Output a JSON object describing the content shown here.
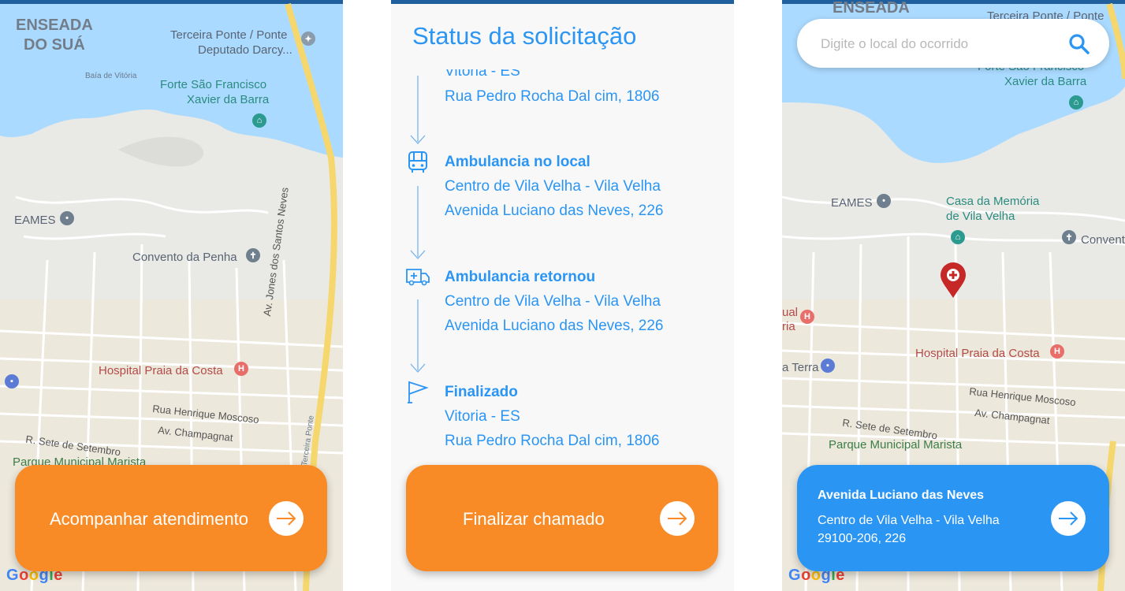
{
  "screen_left": {
    "map_labels": {
      "enseada_1": "ENSEADA",
      "enseada_2": "DO SUÁ",
      "terceira_ponte_1": "Terceira Ponte / Ponte",
      "terceira_ponte_2": "Deputado Darcy...",
      "baia": "Baía de Vitória",
      "forte_1": "Forte São Francisco",
      "forte_2": "Xavier da Barra",
      "eames": "EAMES",
      "convento": "Convento da Penha",
      "hospital": "Hospital Praia da Costa",
      "rua_henrique": "Rua Henrique Moscoso",
      "av_champagnat": "Av. Champagnat",
      "r_sete": "R. Sete de Setembro",
      "parque": "Parque Municipal Marista",
      "av_jones": "Av. Jones dos Santos Neves",
      "terceira_ponte_road": "Terceira Ponte"
    },
    "button_label": "Acompanhar atendimento"
  },
  "screen_middle": {
    "title": "Status da solicitação",
    "steps": [
      {
        "title": "",
        "line1": "Vitoria - ES",
        "line2": "Rua Pedro Rocha Dal cim, 1806",
        "icon": "arrow-down-icon"
      },
      {
        "title": "Ambulancia no local",
        "line1": "Centro de Vila Velha - Vila Velha",
        "line2": "Avenida Luciano das Neves, 226",
        "icon": "bus-icon"
      },
      {
        "title": "Ambulancia retornou",
        "line1": "Centro de Vila Velha - Vila Velha",
        "line2": "Avenida Luciano das Neves, 226",
        "icon": "ambulance-icon"
      },
      {
        "title": "Finalizado",
        "line1": "Vitoria - ES",
        "line2": "Rua Pedro Rocha Dal cim, 1806",
        "icon": "flag-icon"
      }
    ],
    "button_label": "Finalizar chamado"
  },
  "screen_right": {
    "search_placeholder": "Digite o local do ocorrido",
    "map_labels": {
      "enseada": "ENSEADA",
      "terceira_ponte": "Terceira Ponte / Ponte",
      "forte_1": "Forte São Francisco",
      "forte_2": "Xavier da Barra",
      "eames": "EAMES",
      "casa_1": "Casa da Memória",
      "casa_2": "de Vila Velha",
      "convento": "Convent",
      "hospital": "Hospital Praia da Costa",
      "rua_henrique": "Rua Henrique Moscoso",
      "av_champagnat": "Av. Champagnat",
      "r_sete": "R. Sete de Setembro",
      "parque": "Parque Municipal Marista",
      "terra": "a Terra",
      "ual": "ual",
      "ria": "ria"
    },
    "card": {
      "title": "Avenida Luciano das Neves",
      "line1": "Centro de Vila Velha - Vila Velha",
      "line2": "29100-206, 226"
    }
  },
  "google_logo": "Google",
  "colors": {
    "primary_blue": "#2b95f4",
    "orange": "#f98b27",
    "water": "#aadaff",
    "marker_red": "#c62828"
  }
}
